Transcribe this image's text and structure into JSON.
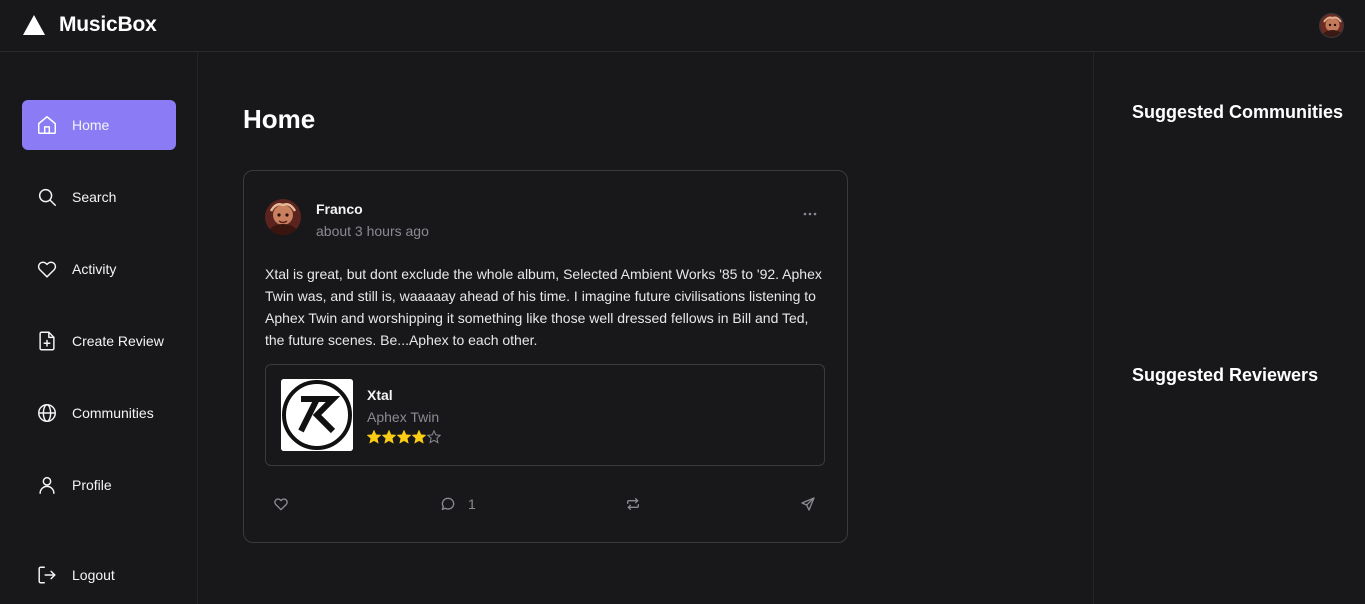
{
  "app": {
    "brand": "MusicBox",
    "accent_color": "#8b7cf6",
    "logo_icon": "triangle-logo-icon",
    "user_avatar_icon": "user-avatar"
  },
  "sidebar": {
    "items": [
      {
        "label": "Home",
        "icon": "home-icon",
        "active": true
      },
      {
        "label": "Search",
        "icon": "search-icon"
      },
      {
        "label": "Activity",
        "icon": "heart-icon"
      },
      {
        "label": "Create Review",
        "icon": "file-plus-icon"
      },
      {
        "label": "Communities",
        "icon": "globe-icon"
      },
      {
        "label": "Profile",
        "icon": "user-icon"
      }
    ],
    "logout": {
      "label": "Logout",
      "icon": "logout-icon"
    }
  },
  "main": {
    "title": "Home",
    "post": {
      "user": "Franco",
      "time": "about 3 hours ago",
      "more_icon": "more-horizontal-icon",
      "body": "Xtal is great, but dont exclude the whole album, Selected Ambient Works '85 to '92. Aphex Twin was, and still is, waaaaay ahead of his time. I imagine future civilisations listening to Aphex Twin and worshipping it something like those well dressed fellows in Bill and Ted, the future scenes. Be...Aphex to each other.",
      "album": {
        "title": "Xtal",
        "artist": "Aphex Twin",
        "rating": 4,
        "rating_max": 5,
        "star_color": "#facc15"
      },
      "actions": {
        "like_icon": "heart-icon",
        "comment_icon": "comment-icon",
        "comment_count": "1",
        "repost_icon": "repost-icon",
        "share_icon": "send-icon"
      }
    }
  },
  "rightbar": {
    "communities_heading": "Suggested Communities",
    "reviewers_heading": "Suggested Reviewers"
  }
}
